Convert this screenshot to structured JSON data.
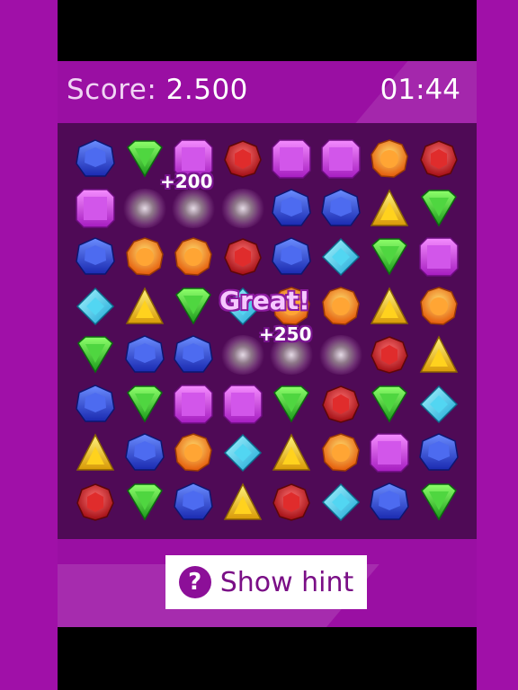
{
  "header": {
    "score_label": "Score:",
    "score_value": "2.500",
    "timer": "01:44"
  },
  "board": {
    "rows": [
      [
        "blue",
        "green",
        "purple",
        "red",
        "purple",
        "purple",
        "orange",
        "red"
      ],
      [
        "purple",
        "spark",
        "spark",
        "spark",
        "blue",
        "blue",
        "yellow",
        "green"
      ],
      [
        "blue",
        "orange",
        "orange",
        "red",
        "blue",
        "cyan",
        "green",
        "purple"
      ],
      [
        "cyan",
        "yellow",
        "green",
        "cyan",
        "orange",
        "orange",
        "yellow",
        "orange"
      ],
      [
        "green",
        "blue",
        "blue",
        "spark",
        "spark",
        "spark",
        "red",
        "yellow"
      ],
      [
        "blue",
        "green",
        "purple",
        "purple",
        "green",
        "red",
        "green",
        "cyan"
      ],
      [
        "yellow",
        "blue",
        "orange",
        "cyan",
        "yellow",
        "orange",
        "purple",
        "blue"
      ],
      [
        "red",
        "green",
        "blue",
        "yellow",
        "red",
        "cyan",
        "blue",
        "green"
      ]
    ]
  },
  "popups": {
    "points_1": "+200",
    "points_2": "+250",
    "praise": "Great!"
  },
  "hint_button": {
    "icon": "question-icon",
    "icon_glyph": "?",
    "label": "Show hint"
  },
  "colors": {
    "background": "#a010a8",
    "board": "#4f0a56",
    "button_text": "#7a0f86"
  }
}
